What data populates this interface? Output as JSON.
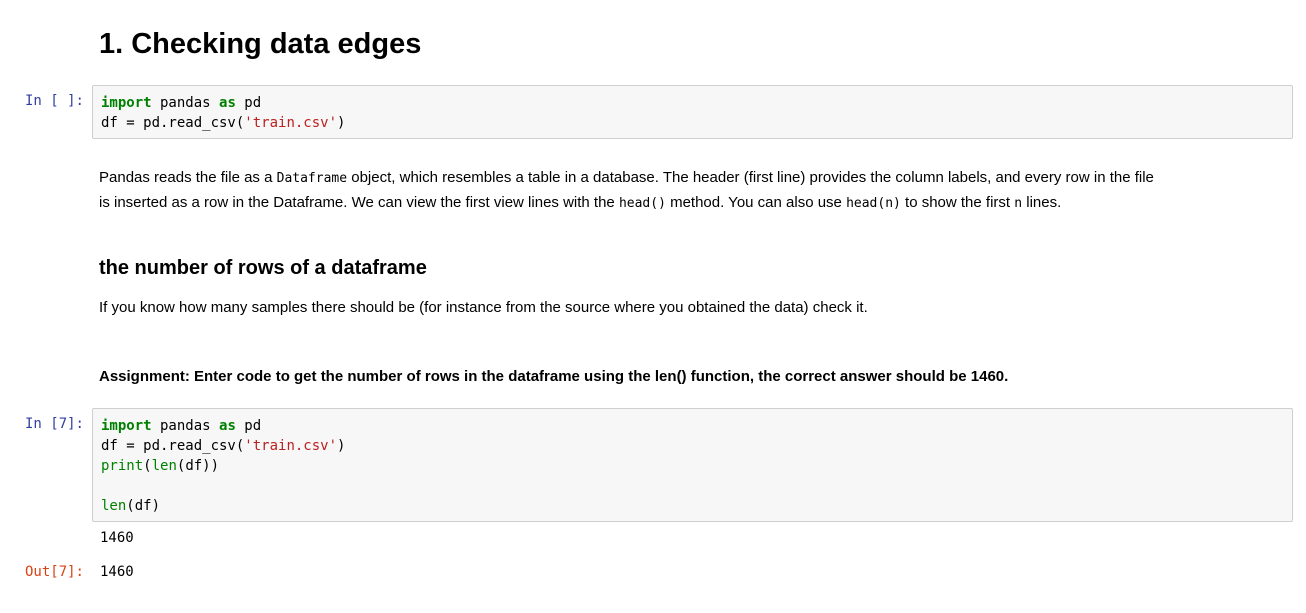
{
  "heading1": "1. Checking data edges",
  "cell1": {
    "prompt": "In [ ]:",
    "line1": {
      "kw1": "import",
      "t1": " pandas ",
      "kw2": "as",
      "t2": " pd"
    },
    "line2": {
      "t1": "df = pd.read_csv(",
      "str": "'train.csv'",
      "t2": ")"
    }
  },
  "para1": {
    "s1": "Pandas reads the file as a ",
    "c1": "Dataframe",
    "s2": " object, which resembles a table in a database. The header (first line) provides the column labels, and every row in the file",
    "s3": "is inserted as a row in the Dataframe. We can view the first view lines with the ",
    "c2": "head()",
    "s4": " method. You can also use ",
    "c3": "head(n)",
    "s5": " to show the first ",
    "c4": "n",
    "s6": " lines."
  },
  "heading2": "the number of rows of a dataframe",
  "para2": "If you know how many samples there should be (for instance from the source where you obtained the data) check it.",
  "assignment": "Assignment: Enter code to get the number of rows in the dataframe using the len() function, the correct answer should be 1460.",
  "cell2": {
    "prompt": "In [7]:",
    "line1": {
      "kw1": "import",
      "t1": " pandas ",
      "kw2": "as",
      "t2": " pd"
    },
    "line2": {
      "t1": "df = pd.read_csv(",
      "str": "'train.csv'",
      "t2": ")"
    },
    "line3": {
      "b1": "print",
      "t1": "(",
      "b2": "len",
      "t2": "(df))"
    },
    "line5": {
      "b1": "len",
      "t1": "(df)"
    },
    "stdout": "1460",
    "out_prompt": "Out[7]:",
    "out_value": "1460"
  }
}
